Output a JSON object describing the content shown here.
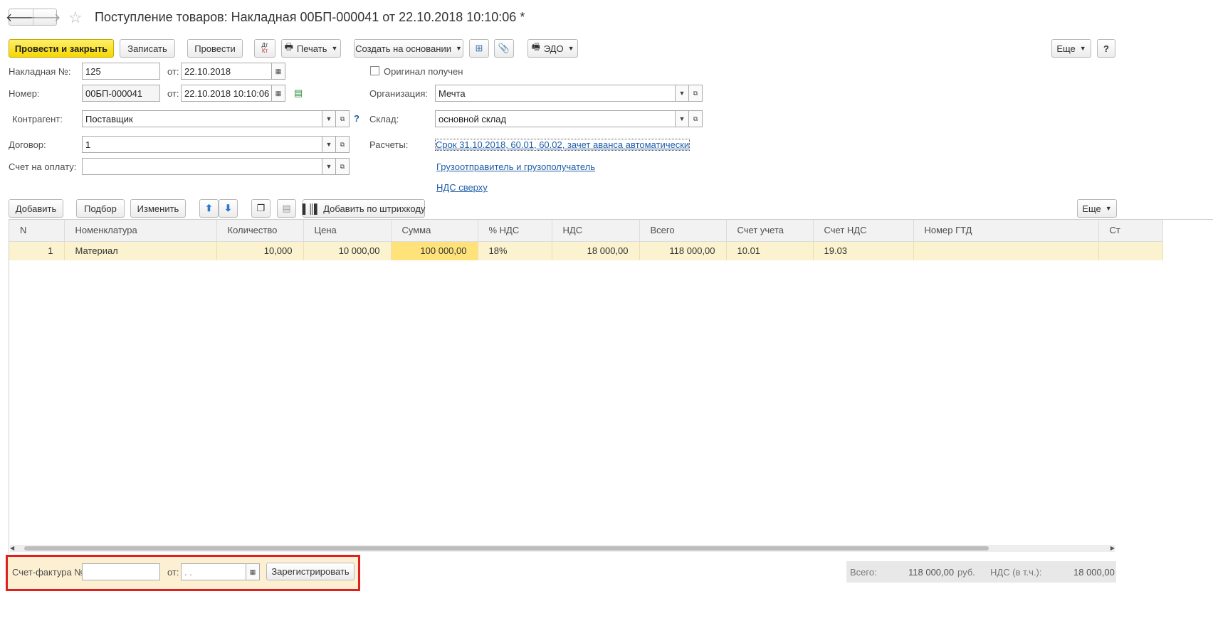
{
  "window": {
    "title": "Поступление товаров: Накладная 00БП-000041 от 22.10.2018 10:10:06 *"
  },
  "toolbar": {
    "post_close": "Провести и закрыть",
    "save": "Записать",
    "post": "Провести",
    "dtkt": "Дт Кт",
    "print": "Печать",
    "create_based": "Создать на основании",
    "edo": "ЭДО",
    "more": "Еще",
    "help": "?"
  },
  "form": {
    "invoice_label": "Накладная №:",
    "invoice_value": "125",
    "from_label": "от:",
    "invoice_date": "22.10.2018",
    "original_label": "Оригинал получен",
    "number_label": "Номер:",
    "number_value": "00БП-000041",
    "number_date": "22.10.2018 10:10:06",
    "org_label": "Организация:",
    "org_value": "Мечта",
    "counterparty_label": "Контрагент:",
    "counterparty_value": "Поставщик",
    "question": "?",
    "warehouse_label": "Склад:",
    "warehouse_value": "основной склад",
    "contract_label": "Договор:",
    "contract_value": "1",
    "settlements_label": "Расчеты:",
    "settlements_link": "Срок 31.10.2018, 60.01, 60.02, зачет аванса автоматически",
    "payment_label": "Счет на оплату:",
    "payment_value": "",
    "shipper_link": "Грузоотправитель и грузополучатель",
    "vat_link": "НДС сверху"
  },
  "table_toolbar": {
    "add": "Добавить",
    "select": "Подбор",
    "change": "Изменить",
    "barcode": "Добавить по штрихкоду",
    "more": "Еще"
  },
  "table": {
    "columns": [
      "N",
      "Номенклатура",
      "Количество",
      "Цена",
      "Сумма",
      "% НДС",
      "НДС",
      "Всего",
      "Счет учета",
      "Счет НДС",
      "Номер ГТД",
      "Ст"
    ],
    "rows": [
      [
        "1",
        "Материал",
        "10,000",
        "10 000,00",
        "100 000,00",
        "18%",
        "18 000,00",
        "118 000,00",
        "10.01",
        "19.03",
        "",
        ""
      ]
    ]
  },
  "footer": {
    "invoice_label": "Счет-фактура №:",
    "invoice_value": "",
    "from_label": "от:",
    "date_value": " .  .",
    "register": "Зарегистрировать",
    "total_label": "Всего:",
    "total_value": "118 000,00",
    "currency": "руб.",
    "vat_label": "НДС (в т.ч.):",
    "vat_value": "18 000,00"
  },
  "colors": {
    "primary": "#f5d700",
    "link": "#1f5ea8",
    "row_bg": "#fbf3cf",
    "highlight_frame": "#e0201f"
  }
}
